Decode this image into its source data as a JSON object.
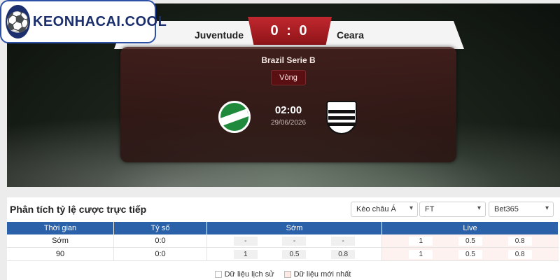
{
  "brand": {
    "logo_text": "KEONHACAI.COOL",
    "logo_icon": "soccer-ball-icon"
  },
  "match": {
    "home": "Juventude",
    "away": "Ceara",
    "score": "0 : 0",
    "league": "Brazil Serie B",
    "round": "Vòng",
    "time": "02:00",
    "date": "29/06/2026",
    "home_crest": "juventude-crest-icon",
    "away_crest": "ceara-crest-icon"
  },
  "odds": {
    "title": "Phân tích tỷ lệ cược trực tiếp",
    "filters": [
      {
        "value": "Kèo châu Á"
      },
      {
        "value": "FT"
      },
      {
        "value": "Bet365"
      }
    ],
    "headers": [
      "Thời gian",
      "Tỷ số",
      "Sớm",
      "Live"
    ],
    "rows": [
      {
        "time": "Sớm",
        "score": "0:0",
        "early": [
          "-",
          "-",
          "-"
        ],
        "live": [
          "1",
          "0.5",
          "0.8"
        ]
      },
      {
        "time": "90",
        "score": "0:0",
        "early": [
          "1",
          "0.5",
          "0.8"
        ],
        "live": [
          "1",
          "0.5",
          "0.8"
        ]
      }
    ],
    "legend": {
      "history": "Dữ liệu lịch sử",
      "latest": "Dữ liệu mới nhất"
    }
  },
  "colors": {
    "header_blue": "#2a61a8",
    "score_red": "#c0282e",
    "live_bg": "#fdf2ef"
  }
}
